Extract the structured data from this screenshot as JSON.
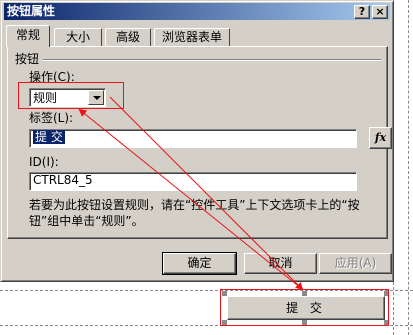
{
  "dialog": {
    "title": "按钮属性",
    "help_glyph": "?",
    "close_glyph": "×",
    "tabs": [
      {
        "label": "常规"
      },
      {
        "label": "大小"
      },
      {
        "label": "高级"
      },
      {
        "label": "浏览器表单"
      }
    ],
    "group_label": "按钮",
    "action": {
      "label": "操作(C):",
      "value": "规则"
    },
    "caption": {
      "label": "标签(L):",
      "value": "提 交"
    },
    "fx_label": "fx",
    "id_field": {
      "label": "ID(I):",
      "value": "CTRL84_5"
    },
    "description": "若要为此按钮设置规则，请在“控件工具”上下文选项卡上的“按钮”组中单击“规则”。",
    "buttons": {
      "ok": "确定",
      "cancel": "取消",
      "apply": "应用(A)"
    }
  },
  "form": {
    "submit_label": "提 交"
  },
  "colors": {
    "highlight_red": "#e8141a",
    "title_start": "#0a246a",
    "title_end": "#a6caf0",
    "face": "#d4d0c8"
  }
}
